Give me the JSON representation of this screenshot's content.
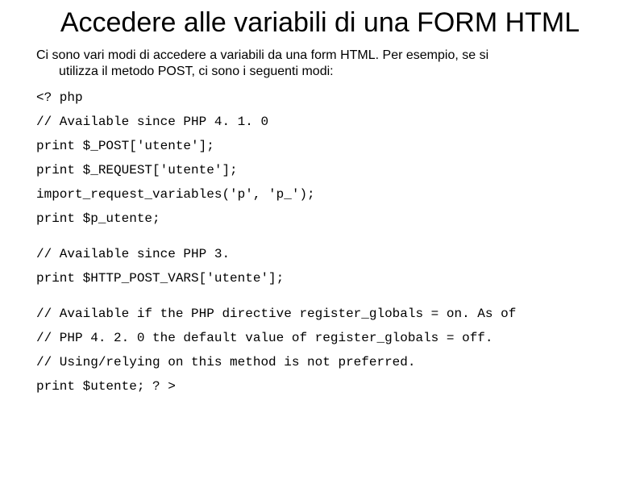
{
  "title": "Accedere alle variabili di una FORM HTML",
  "intro_line1": "Ci sono vari modi di accedere a variabili da una form HTML. Per esempio, se si",
  "intro_line2": "utilizza il metodo POST, ci sono i seguenti modi:",
  "code": {
    "l1": "<? php",
    "l2": "// Available since PHP 4. 1. 0",
    "l3": "print $_POST['utente'];",
    "l4": "print $_REQUEST['utente'];",
    "l5": "import_request_variables('p', 'p_');",
    "l6": "print $p_utente;",
    "l7": "// Available since PHP 3.",
    "l8": "print $HTTP_POST_VARS['utente'];",
    "l9": "// Available if the PHP directive register_globals = on. As of",
    "l10": "// PHP 4. 2. 0 the default value of register_globals = off.",
    "l11": "// Using/relying on this method is not preferred.",
    "l12": "print $utente; ? >"
  }
}
